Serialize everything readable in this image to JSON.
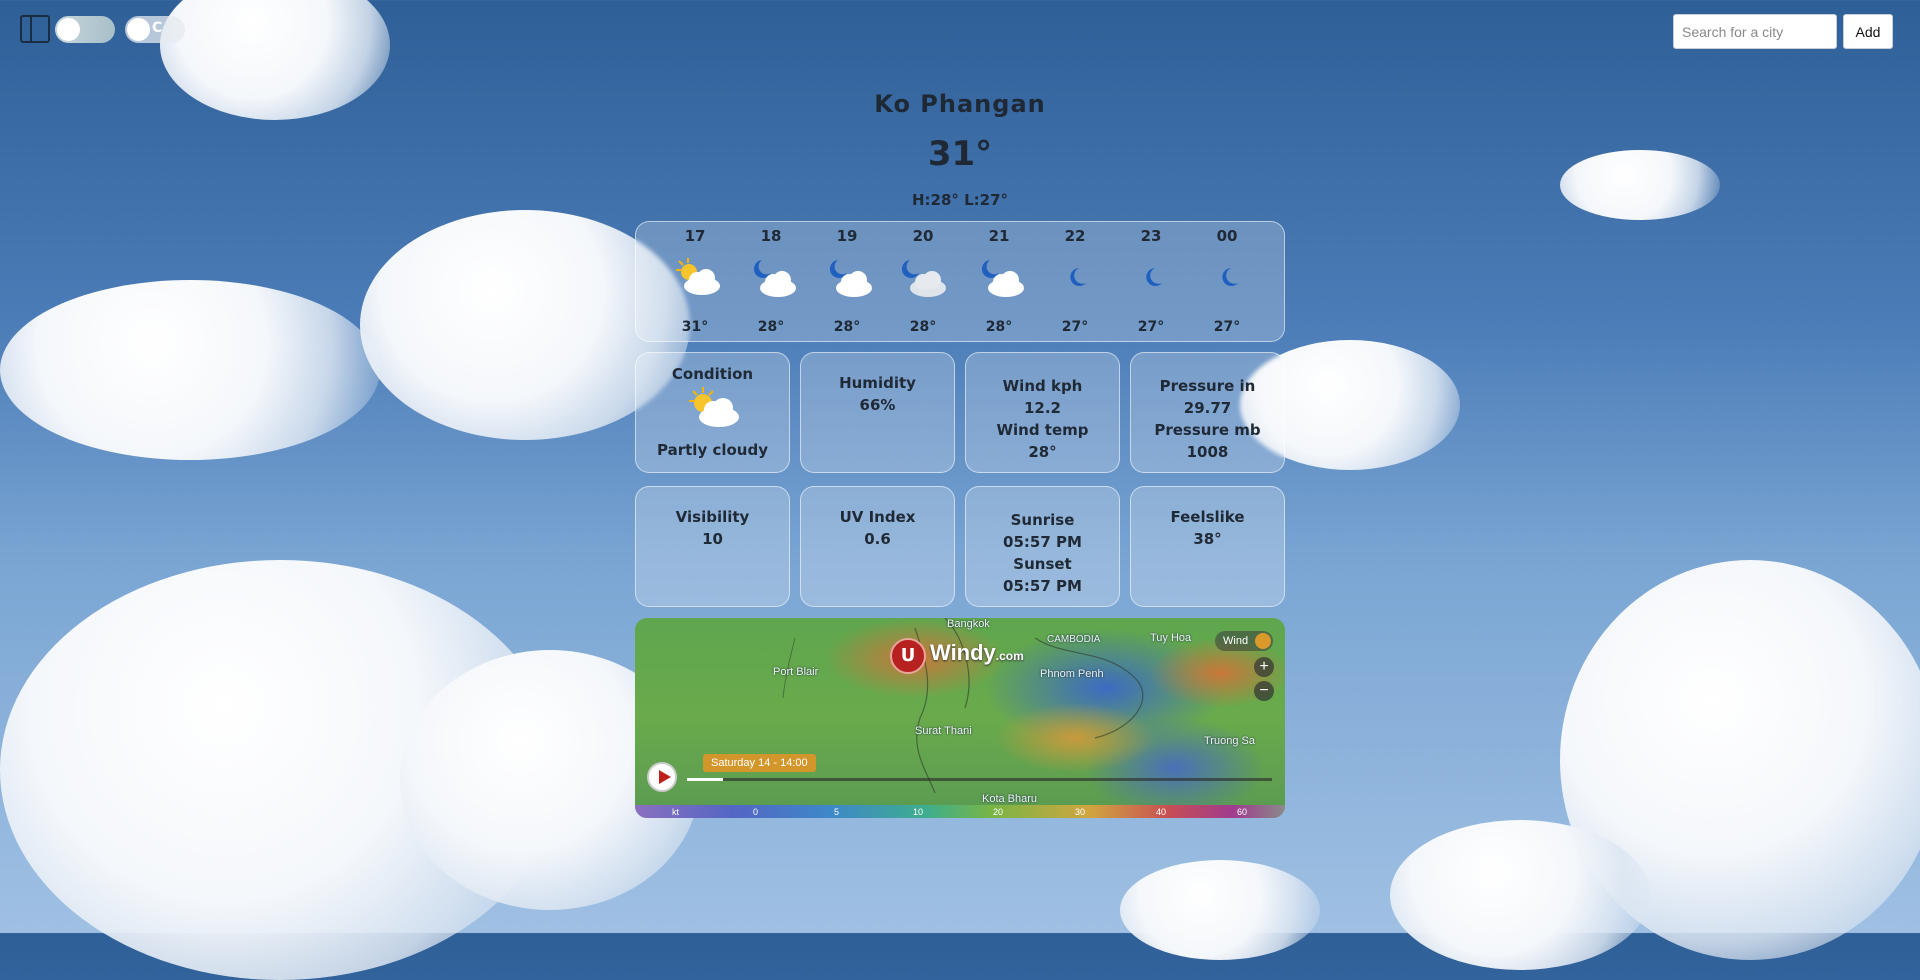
{
  "top_controls": {
    "theme_toggle_label": "",
    "unit_toggle_label": "C"
  },
  "search": {
    "placeholder": "Search for a city",
    "value": "",
    "add_label": "Add"
  },
  "current": {
    "city": "Ko Phangan",
    "temperature": "31°",
    "high_low": "H:28° L:27°"
  },
  "hourly": [
    {
      "hour": "17",
      "temp": "31°",
      "icon": "partly-cloudy-sun-icon"
    },
    {
      "hour": "18",
      "temp": "28°",
      "icon": "partly-cloudy-night-icon"
    },
    {
      "hour": "19",
      "temp": "28°",
      "icon": "partly-cloudy-night-icon"
    },
    {
      "hour": "20",
      "temp": "28°",
      "icon": "cloudy-night-icon"
    },
    {
      "hour": "21",
      "temp": "28°",
      "icon": "partly-cloudy-night-icon"
    },
    {
      "hour": "22",
      "temp": "27°",
      "icon": "moon-icon"
    },
    {
      "hour": "23",
      "temp": "27°",
      "icon": "moon-icon"
    },
    {
      "hour": "00",
      "temp": "27°",
      "icon": "moon-icon"
    }
  ],
  "cards": {
    "condition": {
      "label": "Condition",
      "value": "Partly cloudy",
      "icon": "partly-cloudy-sun-icon"
    },
    "humidity": {
      "label": "Humidity",
      "value": "66%"
    },
    "wind": {
      "kph_label": "Wind kph",
      "kph_value": "12.2",
      "temp_label": "Wind temp",
      "temp_value": "28°"
    },
    "pressure": {
      "in_label": "Pressure in",
      "in_value": "29.77",
      "mb_label": "Pressure mb",
      "mb_value": "1008"
    },
    "visibility": {
      "label": "Visibility",
      "value": "10"
    },
    "uv": {
      "label": "UV Index",
      "value": "0.6"
    },
    "sun": {
      "sunrise_label": "Sunrise",
      "sunrise_value": "05:57 PM",
      "sunset_label": "Sunset",
      "sunset_value": "05:57 PM"
    },
    "feelslike": {
      "label": "Feelslike",
      "value": "38°"
    }
  },
  "map": {
    "brand": "Windy",
    "brand_suffix": ".com",
    "layer_label": "Wind",
    "zoom_in": "+",
    "zoom_out": "−",
    "time_label": "Saturday 14 - 14:00",
    "places": [
      "Bangkok",
      "CAMBODIA",
      "Tuy Hoa",
      "Port Blair",
      "Phnom Penh",
      "Surat Thani",
      "Truong Sa",
      "Kota Bharu"
    ],
    "scale_unit": "kt",
    "scale_ticks": [
      "0",
      "5",
      "10",
      "20",
      "30",
      "40",
      "60"
    ]
  },
  "colors": {
    "sky_top": "#2f5f97",
    "sky_bottom": "#9fc0e3",
    "text": "#1e2935",
    "windy_red": "#b7211f"
  }
}
